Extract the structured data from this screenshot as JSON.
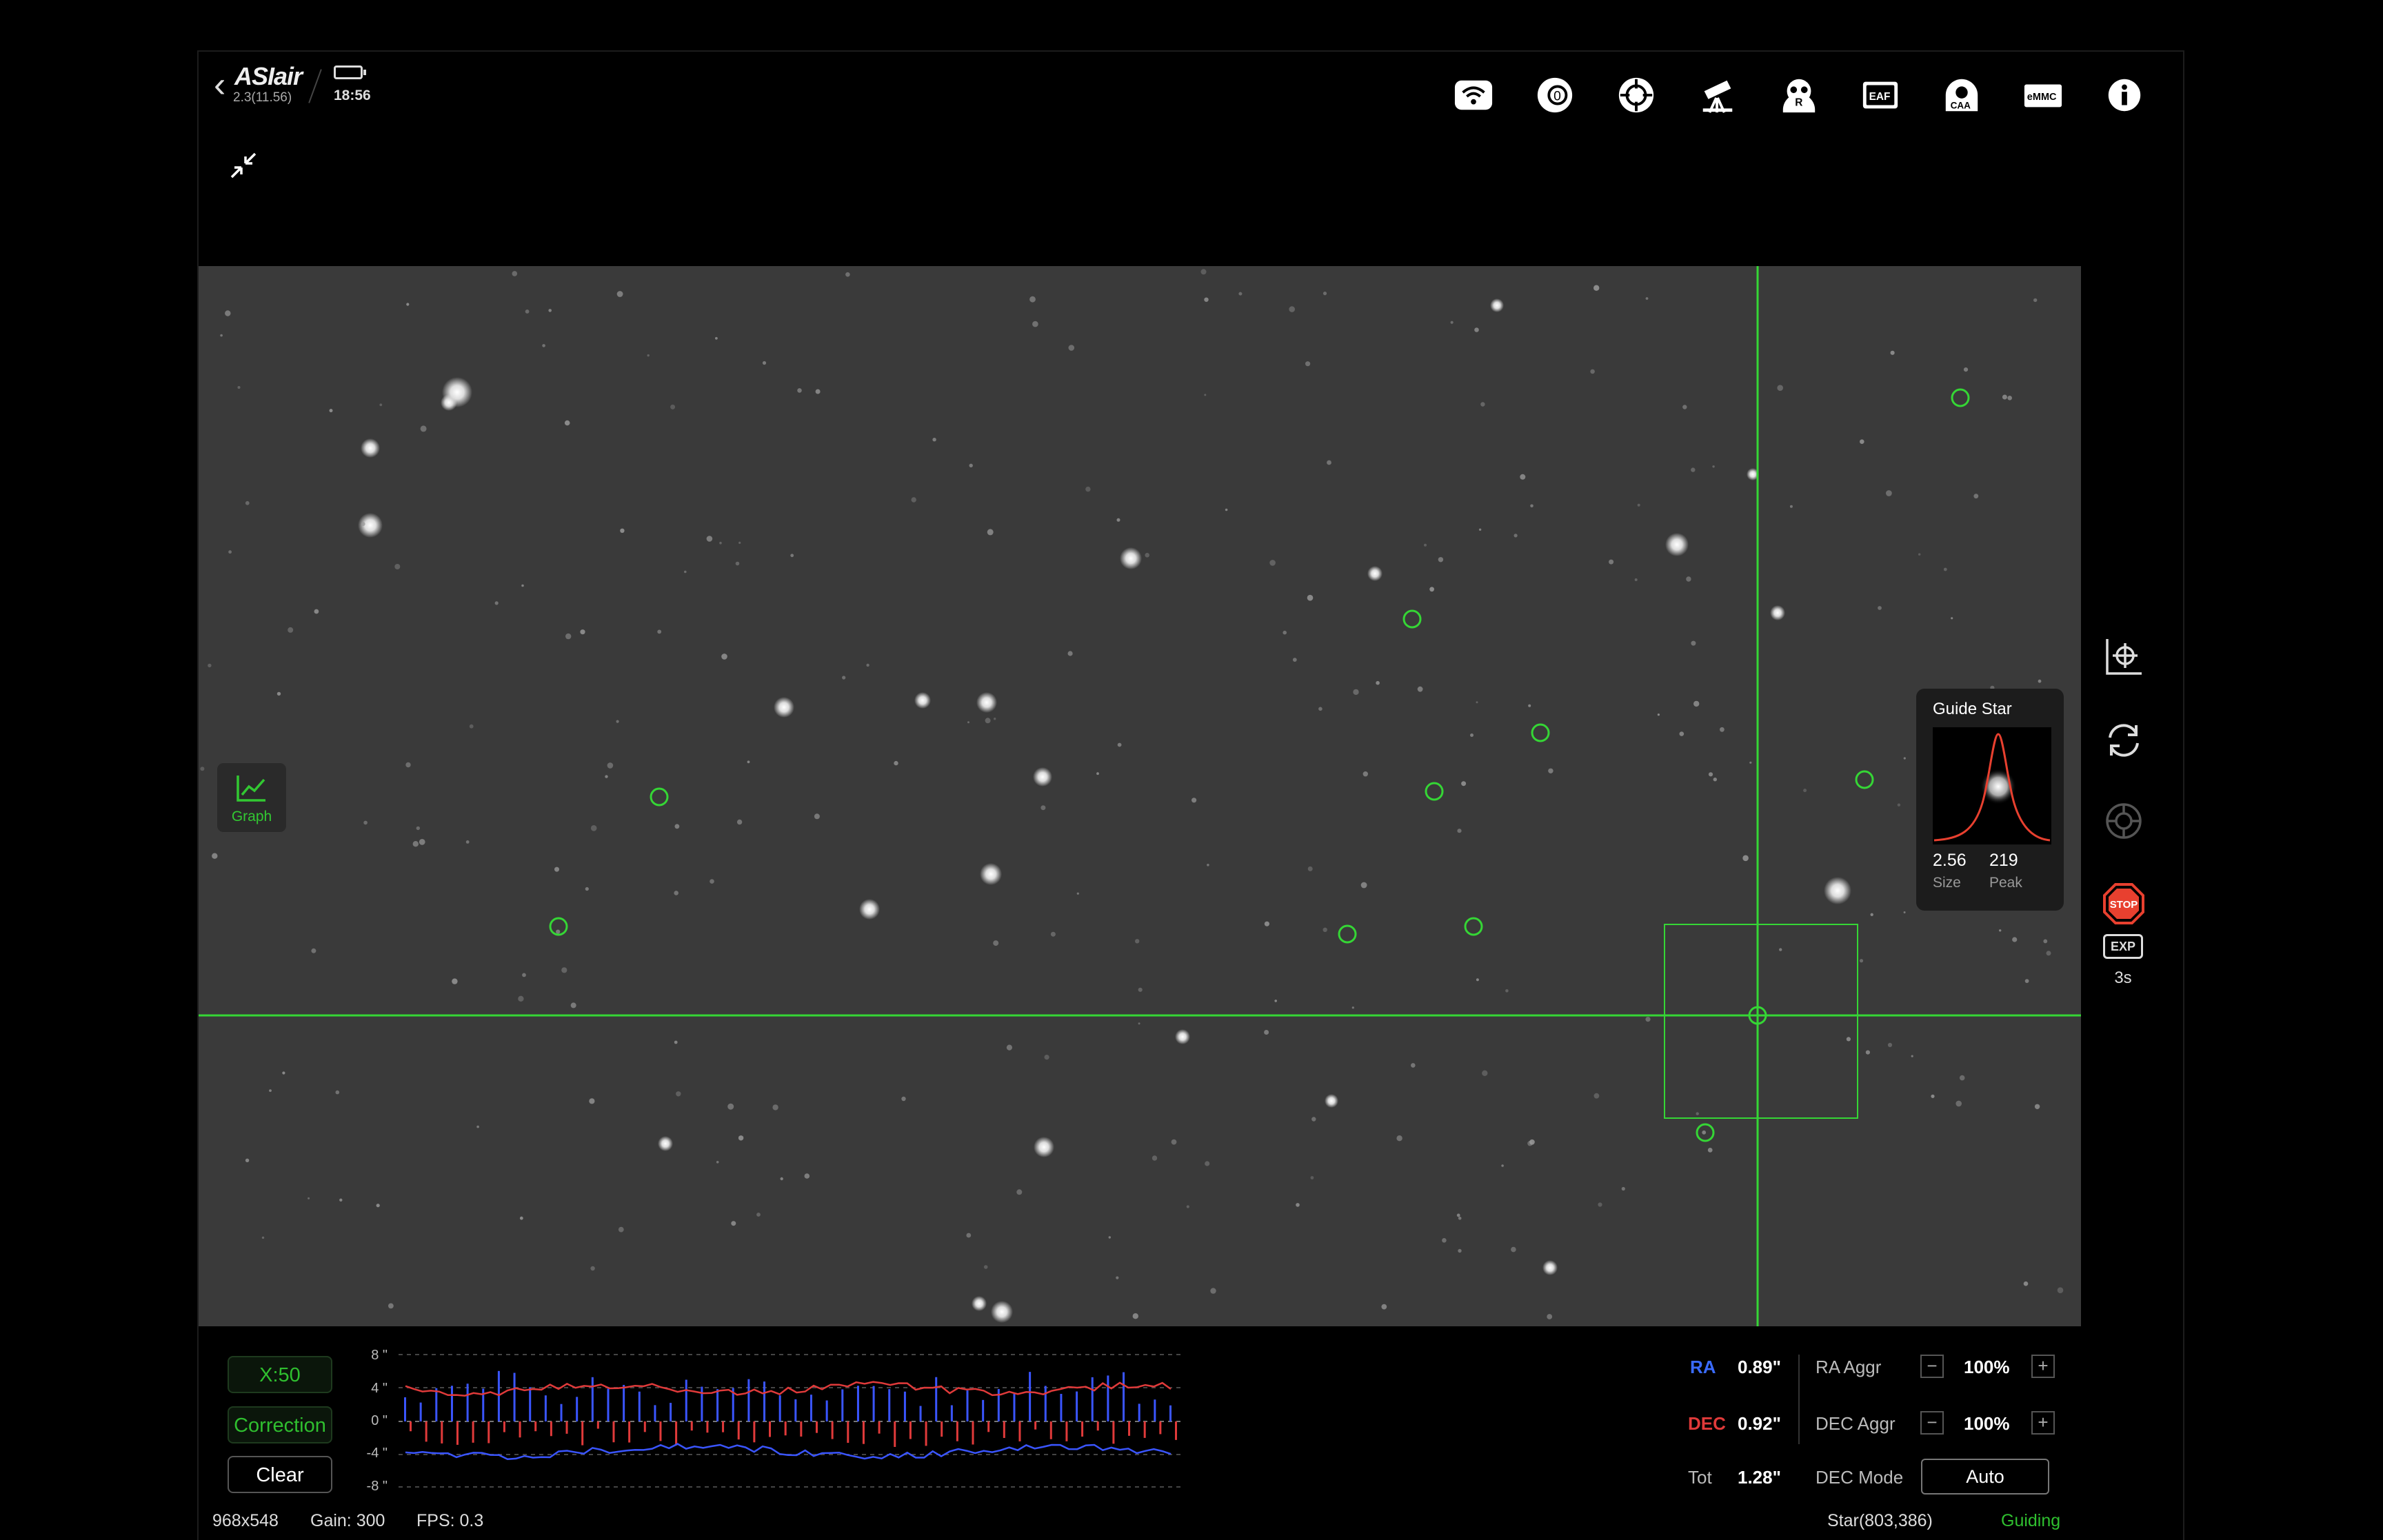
{
  "header": {
    "brand": "ASIair",
    "version": "2.3(11.56)",
    "clock": "18:56",
    "icons": [
      "wifi-icon",
      "camera-icon",
      "guide-target-icon",
      "telescope-icon",
      "filter-wheel-icon",
      "eaf-icon",
      "caa-icon",
      "emmc-icon",
      "info-icon"
    ]
  },
  "colors": {
    "accent_green": "#2fbf2f",
    "ra_blue": "#3a55ff",
    "dec_red": "#e03a3a",
    "stop_red": "#e8402f",
    "crosshair": "#35d635"
  },
  "overlay": {
    "graph_label": "Graph",
    "guide_star": {
      "title": "Guide Star",
      "size_value": "2.56",
      "size_label": "Size",
      "peak_value": "219",
      "peak_label": "Peak"
    }
  },
  "right_toolbar": {
    "items": [
      "calibrate-icon",
      "loop-icon",
      "target-icon",
      "stop-icon"
    ],
    "exp_label": "EXP",
    "exp_value": "3s"
  },
  "bottom": {
    "scale_button": "X:50",
    "correction_button": "Correction",
    "clear_button": "Clear",
    "y_labels": [
      "8 \"",
      "4 \"",
      "0 \"",
      "-4 \"",
      "-8 \""
    ],
    "ra_label": "RA",
    "ra_value": "0.89\"",
    "dec_label": "DEC",
    "dec_value": "0.92\"",
    "tot_label": "Tot",
    "tot_value": "1.28\"",
    "ra_aggr_label": "RA Aggr",
    "ra_aggr_value": "100%",
    "dec_aggr_label": "DEC Aggr",
    "dec_aggr_value": "100%",
    "dec_mode_label": "DEC Mode",
    "dec_mode_value": "Auto",
    "minus": "−",
    "plus": "+"
  },
  "status_bar": {
    "resolution": "968x548",
    "gain": "Gain: 300",
    "fps": "FPS: 0.3",
    "star": "Star(803,386)",
    "state": "Guiding"
  }
}
